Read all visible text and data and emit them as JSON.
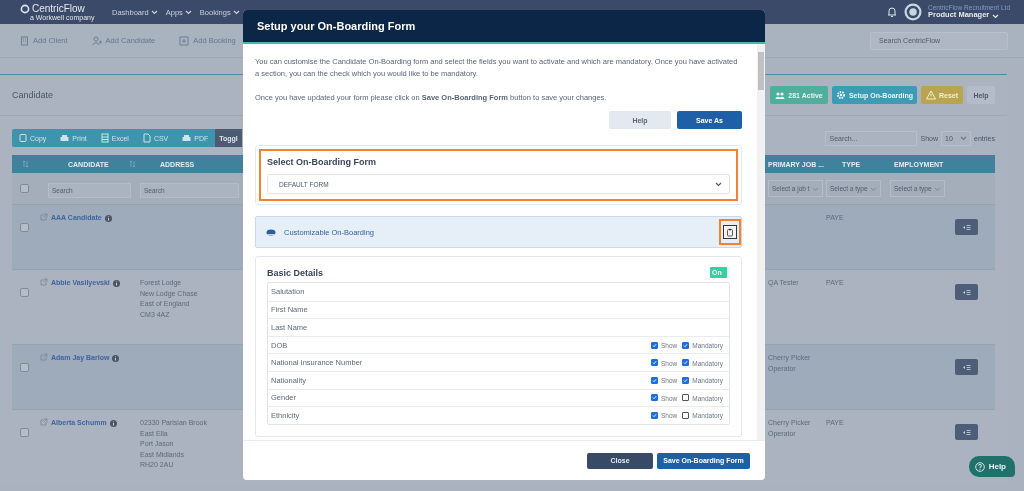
{
  "nav": {
    "logo": "CentricFlow",
    "tagline": "a Workwell company",
    "menu": [
      {
        "label": "Dashboard"
      },
      {
        "label": "Apps"
      },
      {
        "label": "Bookings"
      }
    ],
    "company": "CentricFlow Recruitment Ltd",
    "role": "Product Manager"
  },
  "quick_actions": [
    {
      "label": "Add Client",
      "kind": "client"
    },
    {
      "label": "Add Candidate",
      "kind": "candidate"
    },
    {
      "label": "Add Booking",
      "kind": "booking"
    }
  ],
  "global_search": {
    "placeholder": "Search CentricFlow"
  },
  "page": {
    "title": "Candidate",
    "buttons": [
      {
        "label": "281 Active",
        "kind": "active"
      },
      {
        "label": "Setup On-Boarding",
        "kind": "setup"
      },
      {
        "label": "Reset",
        "kind": "reset"
      },
      {
        "label": "Help",
        "kind": "help"
      }
    ]
  },
  "export_buttons": [
    {
      "label": "Copy",
      "kind": "copy"
    },
    {
      "label": "Print",
      "kind": "print"
    },
    {
      "label": "Excel",
      "kind": "excel"
    },
    {
      "label": "CSV",
      "kind": "csv"
    },
    {
      "label": "PDF",
      "kind": "pdf"
    },
    {
      "label": "Toggl",
      "kind": "toggle"
    }
  ],
  "table": {
    "search": {
      "placeholder": "Search..."
    },
    "select_all": {
      "checked": false
    },
    "show_label": "Show",
    "page_size": "10",
    "entries_label": "entries",
    "columns": [
      {
        "label": "CANDIDATE"
      },
      {
        "label": "ADDRESS"
      },
      {
        "label": "PRIMARY JOB ..."
      },
      {
        "label": "TYPE"
      },
      {
        "label": "EMPLOYMENT"
      }
    ],
    "filters": [
      {
        "kind": "text",
        "placeholder": "Search"
      },
      {
        "kind": "text",
        "placeholder": "Search"
      },
      {
        "kind": "select",
        "placeholder": "Select a job t"
      },
      {
        "kind": "select",
        "placeholder": "Select a type"
      },
      {
        "kind": "select",
        "placeholder": "Select a type"
      }
    ],
    "rows": [
      {
        "checked": false,
        "name": "AAA Candidate",
        "type": "PAYE"
      },
      {
        "checked": false,
        "name": "Abbie Vasilyevski",
        "address": [
          "Forest Lodge",
          "New Lodge Chase",
          "East of England",
          "CM3 4AZ"
        ],
        "primary_job": "QA Tester",
        "type": "PAYE"
      },
      {
        "checked": false,
        "name": "Adam Jay Barlow",
        "primary_job": "Cherry Picker Operator"
      },
      {
        "checked": false,
        "name": "Alberta Schumm",
        "address": [
          "02330 Parisian Brook",
          "East Ella",
          "Port Jason",
          "East Midlands",
          "RH20 2AU"
        ],
        "primary_job": "Cherry Picker Operator",
        "type": "PAYE"
      }
    ]
  },
  "modal": {
    "title": "Setup your On-Boarding Form",
    "intro": "You can customise the Candidate On-Boarding form and select the fields you want to activate and which are mandatory. Once you have activated a section, you can the check which you would like to be mandatory.",
    "note": "Once you have updated your form please click on **Save On-Boarding Form** button to save your changes.",
    "actions": [
      {
        "label": "Help",
        "kind": "secondary"
      },
      {
        "label": "Save As",
        "kind": "primary"
      }
    ],
    "form_select": {
      "label": "Select On-Boarding Form",
      "value": "DEFAULT FORM",
      "highlighted": true
    },
    "section": {
      "title": "Customizable On-Boarding",
      "highlighted": true
    },
    "basic_details": {
      "title": "Basic Details",
      "on": true,
      "toggle_label": "On",
      "fields": [
        {
          "kind": "fixed",
          "label": "Salutation"
        },
        {
          "kind": "fixed",
          "label": "First Name"
        },
        {
          "kind": "fixed",
          "label": "Last Name"
        },
        {
          "kind": "optional",
          "label": "DOB",
          "show": true,
          "show_label": "Show",
          "mandatory": true,
          "mandatory_label": "Mandatory"
        },
        {
          "kind": "optional",
          "label": "National Insurance Number",
          "show": true,
          "show_label": "Show",
          "mandatory": true,
          "mandatory_label": "Mandatory"
        },
        {
          "kind": "optional",
          "label": "Nationality",
          "show": true,
          "show_label": "Show",
          "mandatory": true,
          "mandatory_label": "Mandatory"
        },
        {
          "kind": "optional",
          "label": "Gender",
          "show": true,
          "show_label": "Show",
          "mandatory": false,
          "mandatory_label": "Mandatory"
        },
        {
          "kind": "optional",
          "label": "Ethnicity",
          "show": true,
          "show_label": "Show",
          "mandatory": false,
          "mandatory_label": "Mandatory"
        }
      ]
    },
    "footer": [
      {
        "label": "Close",
        "kind": "dark"
      },
      {
        "label": "Save On-Boarding Form",
        "kind": "primary"
      }
    ]
  },
  "help_fab": {
    "label": "Help"
  }
}
